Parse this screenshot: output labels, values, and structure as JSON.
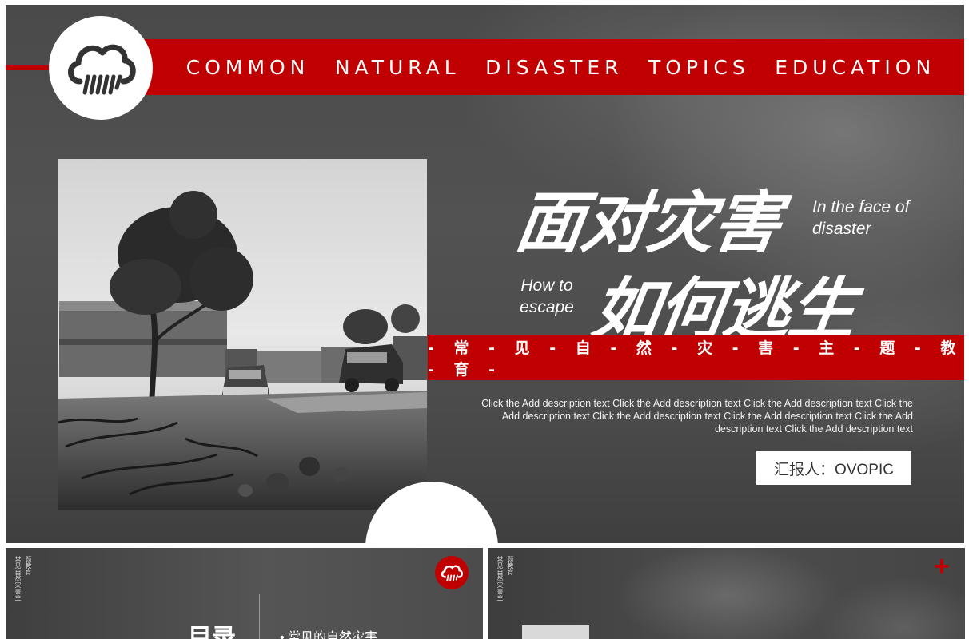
{
  "main_slide": {
    "topbar_words": [
      "COMMON",
      "NATURAL",
      "DISASTER",
      "TOPICS",
      "EDUCATION"
    ],
    "title_line1": "面对灾害",
    "title_line2": "如何逃生",
    "subtitle_en_1": "In the face of disaster",
    "subtitle_en_2": "How to escape",
    "red_band_text": "- 常 - 见 - 自 - 然 - 灾 - 害 - 主 - 题 - 教 - 育 -",
    "description": "Click the Add description  text Click the Add description  text Click the Add description  text  Click the Add description  text Click the Add description  text Click the Add description  text Click the Add description  text Click the Add description  text",
    "reporter": "汇报人：OVOPIC",
    "logo_icon": "rain-cloud-icon",
    "photo": "storm-aftermath-photo"
  },
  "thumb1": {
    "vertical_text": [
      "常见自然灾害主",
      "题教育"
    ],
    "big_char": "目录",
    "bullet": "•   常见的自然灾害",
    "logo_icon": "rain-cloud-icon"
  },
  "thumb2": {
    "vertical_text": [
      "常见自然灾害主",
      "题教育"
    ],
    "plus_icon": "plus-icon"
  },
  "colors": {
    "accent": "#c00000",
    "background": "#4b4b4b",
    "text": "#ffffff"
  }
}
